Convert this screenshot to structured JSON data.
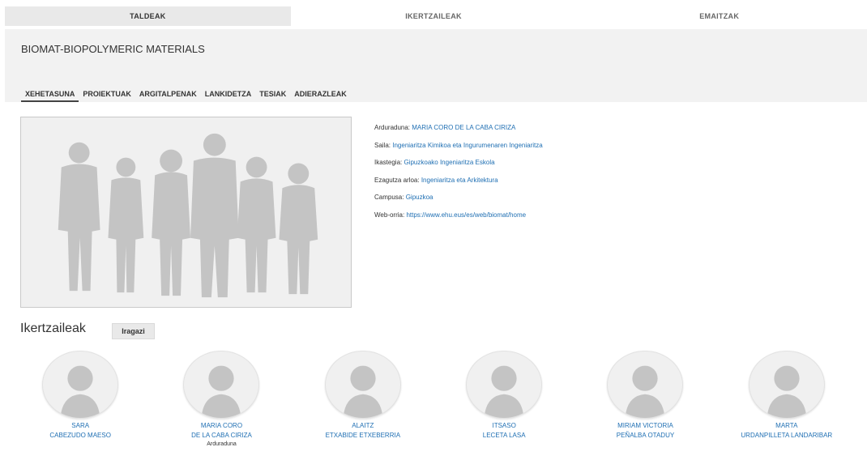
{
  "topnav": {
    "tabs": [
      {
        "label": "TALDEAK",
        "active": true
      },
      {
        "label": "IKERTZAILEAK",
        "active": false
      },
      {
        "label": "EMAITZAK",
        "active": false
      }
    ]
  },
  "group": {
    "title": "BIOMAT-BIOPOLYMERIC MATERIALS"
  },
  "subtabs": [
    {
      "label": "XEHETASUNA",
      "active": true
    },
    {
      "label": "PROIEKTUAK",
      "active": false
    },
    {
      "label": "ARGITALPENAK",
      "active": false
    },
    {
      "label": "LANKIDETZA",
      "active": false
    },
    {
      "label": "TESIAK",
      "active": false
    },
    {
      "label": "ADIERAZLEAK",
      "active": false
    }
  ],
  "details": {
    "arduraduna": {
      "label": "Arduraduna:",
      "value": "MARIA CORO DE LA CABA CIRIZA"
    },
    "saila": {
      "label": "Saila:",
      "value": "Ingeniaritza Kimikoa eta Ingurumenaren Ingeniaritza"
    },
    "ikastegia": {
      "label": "Ikastegia:",
      "value": "Gipuzkoako Ingeniaritza Eskola"
    },
    "ezagutza": {
      "label": "Ezagutza arloa:",
      "value": "Ingeniaritza eta Arkitektura"
    },
    "campusa": {
      "label": "Campusa:",
      "value": "Gipuzkoa"
    },
    "web": {
      "label": "Web-orria:",
      "value": "https://www.ehu.eus/es/web/biomat/home"
    }
  },
  "researchers_section": {
    "title": "Ikertzaileak",
    "filter_label": "Iragazi"
  },
  "researchers": [
    {
      "name1": "SARA",
      "name2": "CABEZUDO MAESO",
      "role": ""
    },
    {
      "name1": "MARIA CORO",
      "name2": "DE LA CABA CIRIZA",
      "role": "Arduraduna"
    },
    {
      "name1": "ALAITZ",
      "name2": "ETXABIDE ETXEBERRIA",
      "role": ""
    },
    {
      "name1": "ITSASO",
      "name2": "LECETA LASA",
      "role": ""
    },
    {
      "name1": "MIRIAM VICTORIA",
      "name2": "PEÑALBA OTADUY",
      "role": ""
    },
    {
      "name1": "MARTA",
      "name2": "URDANPILLETA LANDARIBAR",
      "role": ""
    }
  ],
  "colors": {
    "link": "#1f6fb3",
    "header_bg": "#f2f2f2",
    "active_tab_bg": "#e9e9e9",
    "silhouette": "#c4c4c4"
  }
}
